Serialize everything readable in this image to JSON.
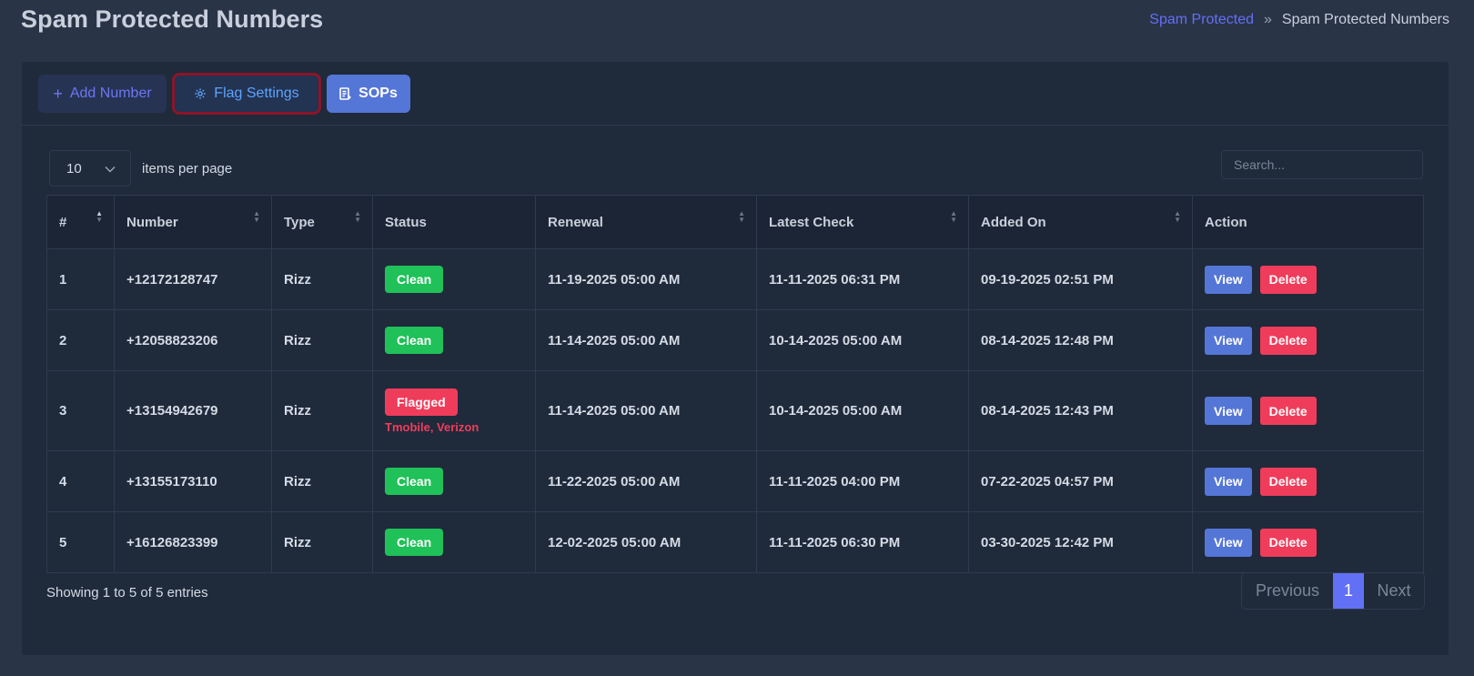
{
  "header": {
    "title": "Spam Protected Numbers",
    "breadcrumb": {
      "link": "Spam Protected",
      "separator": "»",
      "current": "Spam Protected Numbers"
    }
  },
  "toolbar": {
    "add_label": "Add Number",
    "flag_label": "Flag Settings",
    "sops_label": "SOPs"
  },
  "controls": {
    "per_page_value": "10",
    "per_page_label": "items per page",
    "search_placeholder": "Search..."
  },
  "table": {
    "columns": [
      "#",
      "Number",
      "Type",
      "Status",
      "Renewal",
      "Latest Check",
      "Added On",
      "Action"
    ],
    "rows": [
      {
        "idx": "1",
        "number": "+12172128747",
        "type": "Rizz",
        "status": "Clean",
        "carriers": "",
        "renewal": "11-19-2025 05:00 AM",
        "latest_check": "11-11-2025 06:31 PM",
        "added_on": "09-19-2025 02:51 PM"
      },
      {
        "idx": "2",
        "number": "+12058823206",
        "type": "Rizz",
        "status": "Clean",
        "carriers": "",
        "renewal": "11-14-2025 05:00 AM",
        "latest_check": "10-14-2025 05:00 AM",
        "added_on": "08-14-2025 12:48 PM"
      },
      {
        "idx": "3",
        "number": "+13154942679",
        "type": "Rizz",
        "status": "Flagged",
        "carriers": "Tmobile, Verizon",
        "renewal": "11-14-2025 05:00 AM",
        "latest_check": "10-14-2025 05:00 AM",
        "added_on": "08-14-2025 12:43 PM"
      },
      {
        "idx": "4",
        "number": "+13155173110",
        "type": "Rizz",
        "status": "Clean",
        "carriers": "",
        "renewal": "11-22-2025 05:00 AM",
        "latest_check": "11-11-2025 04:00 PM",
        "added_on": "07-22-2025 04:57 PM"
      },
      {
        "idx": "5",
        "number": "+16126823399",
        "type": "Rizz",
        "status": "Clean",
        "carriers": "",
        "renewal": "12-02-2025 05:00 AM",
        "latest_check": "11-11-2025 06:30 PM",
        "added_on": "03-30-2025 12:42 PM"
      }
    ],
    "view_label": "View",
    "delete_label": "Delete"
  },
  "footer": {
    "info": "Showing 1 to 5 of 5 entries",
    "prev": "Previous",
    "page": "1",
    "next": "Next"
  },
  "colors": {
    "accent": "#6270f5",
    "clean": "#1fc158",
    "flagged": "#f03c5b",
    "view": "#5476d6"
  }
}
